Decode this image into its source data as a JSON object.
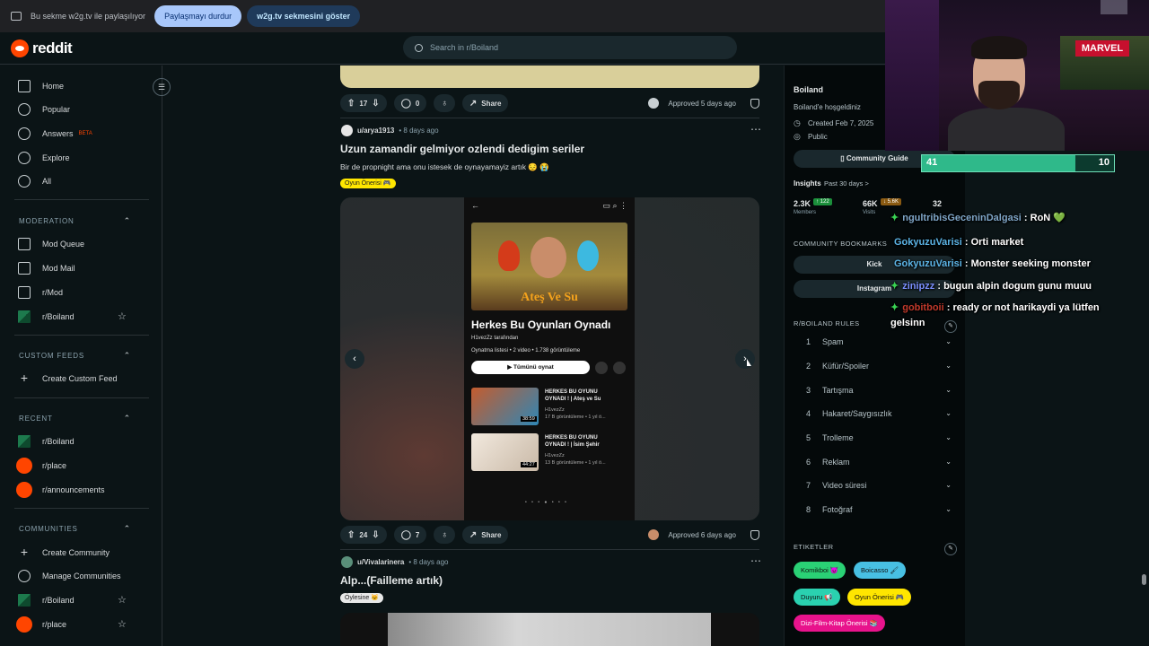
{
  "share_bar": {
    "text": "Bu sekme w2g.tv ile paylaşılıyor",
    "stop_label": "Paylaşmayı durdur",
    "show_label": "w2g.tv sekmesini göster"
  },
  "header": {
    "brand": "reddit",
    "search_placeholder": "Search in r/Boiland"
  },
  "sidebar": {
    "main": [
      "Home",
      "Popular",
      "Answers",
      "Explore",
      "All"
    ],
    "answers_badge": "BETA",
    "moderation_title": "MODERATION",
    "moderation": [
      "Mod Queue",
      "Mod Mail",
      "r/Mod",
      "r/Boiland"
    ],
    "custom_feeds_title": "CUSTOM FEEDS",
    "custom_feeds": [
      "Create Custom Feed"
    ],
    "recent_title": "RECENT",
    "recent": [
      "r/Boiland",
      "r/place",
      "r/announcements"
    ],
    "communities_title": "COMMUNITIES",
    "communities": [
      "Create Community",
      "Manage Communities",
      "r/Boiland",
      "r/place"
    ]
  },
  "post0": {
    "upvotes": "17",
    "comments": "0",
    "share": "Share",
    "approved": "Approved 5 days ago"
  },
  "post1": {
    "user": "u/arya1913",
    "time": "• 8 days ago",
    "title": "Uzun zamandir gelmiyor ozlendi dedigim seriler",
    "body": "Bir de propnight ama onu istesek de oynayamayiz artık 😔 😭",
    "flair": "Oyun Önerisi 🎮",
    "upvotes": "24",
    "comments": "7",
    "share": "Share",
    "approved": "Approved 6 days ago",
    "playlist": {
      "thumb_title": "Ateş Ve Su",
      "title": "Herkes Bu Oyunları Oynadı",
      "by": "H1vezZz tarafından",
      "meta": "Oynatma listesi • 2 video • 1.738 görüntüleme",
      "play_all": "▶  Tümünü oynat",
      "videos": [
        {
          "title": "HERKES BU OYUNU OYNADI ! | Ateş ve Su",
          "channel": "H1vezZz",
          "stats": "17 B görüntüleme • 1 yıl ö...",
          "duration": "38:59"
        },
        {
          "title": "HERKES BU OYUNU OYNADI ! | İsim Şehir",
          "channel": "H1vezZz",
          "stats": "13 B görüntüleme • 1 yıl ö...",
          "duration": "44:27"
        }
      ]
    }
  },
  "post2": {
    "user": "u/Vivalarinera",
    "time": "• 8 days ago",
    "title": "Alp...(Failleme artık)",
    "flair": "Öylesine 🐱"
  },
  "community": {
    "name": "Boiland",
    "welcome": "Boiland'e hoşgeldiniz",
    "created": "Created Feb 7, 2025",
    "visibility": "Public",
    "guide": "Community Guide",
    "insights": "Insights",
    "insights_range": "Past 30 days >",
    "members": "2.3K",
    "members_delta": "↑ 122",
    "members_label": "Members",
    "visits": "66K",
    "visits_delta": "↓ 5.6K",
    "visits_label": "Visits",
    "online": "32",
    "bookmarks_title": "COMMUNITY BOOKMARKS",
    "bookmarks": [
      "Kick",
      "Instagram"
    ],
    "rules_title": "R/BOILAND RULES",
    "rules": [
      "Spam",
      "Küfür/Spoiler",
      "Tartışma",
      "Hakaret/Saygısızlık",
      "Trolleme",
      "Reklam",
      "Video süresi",
      "Fotoğraf"
    ],
    "tags_title": "ETIKETLER",
    "tags": [
      "Komikboi 😈",
      "Boicasso 🖌",
      "Duyuru 📢",
      "Oyun Önerisi 🎮",
      "Dizi-Film-Kitap Önerisi 📚"
    ]
  },
  "stream": {
    "logo": "MARVEL",
    "bar_left": "41",
    "bar_right": "10",
    "bar_fraction": 0.8,
    "chat": [
      {
        "user": "ngultribisGeceninDalgasi",
        "msg": ": RoN 💚"
      },
      {
        "user": "GokyuzuVarisi",
        "msg": ": Orti market"
      },
      {
        "user": "GokyuzuVarisi",
        "msg": ": Monster seeking monster"
      },
      {
        "user": "zinipzz",
        "msg": ": bugun alpin dogum gunu muuu"
      },
      {
        "user": "gobitboii",
        "msg": ": ready or not harikaydi ya lütfen"
      }
    ],
    "chat_cont": "gelsinn"
  },
  "colors": {
    "accent": "#ff4500",
    "stream_bar": "#2fb98a",
    "flair_yellow": "#ffe600"
  }
}
